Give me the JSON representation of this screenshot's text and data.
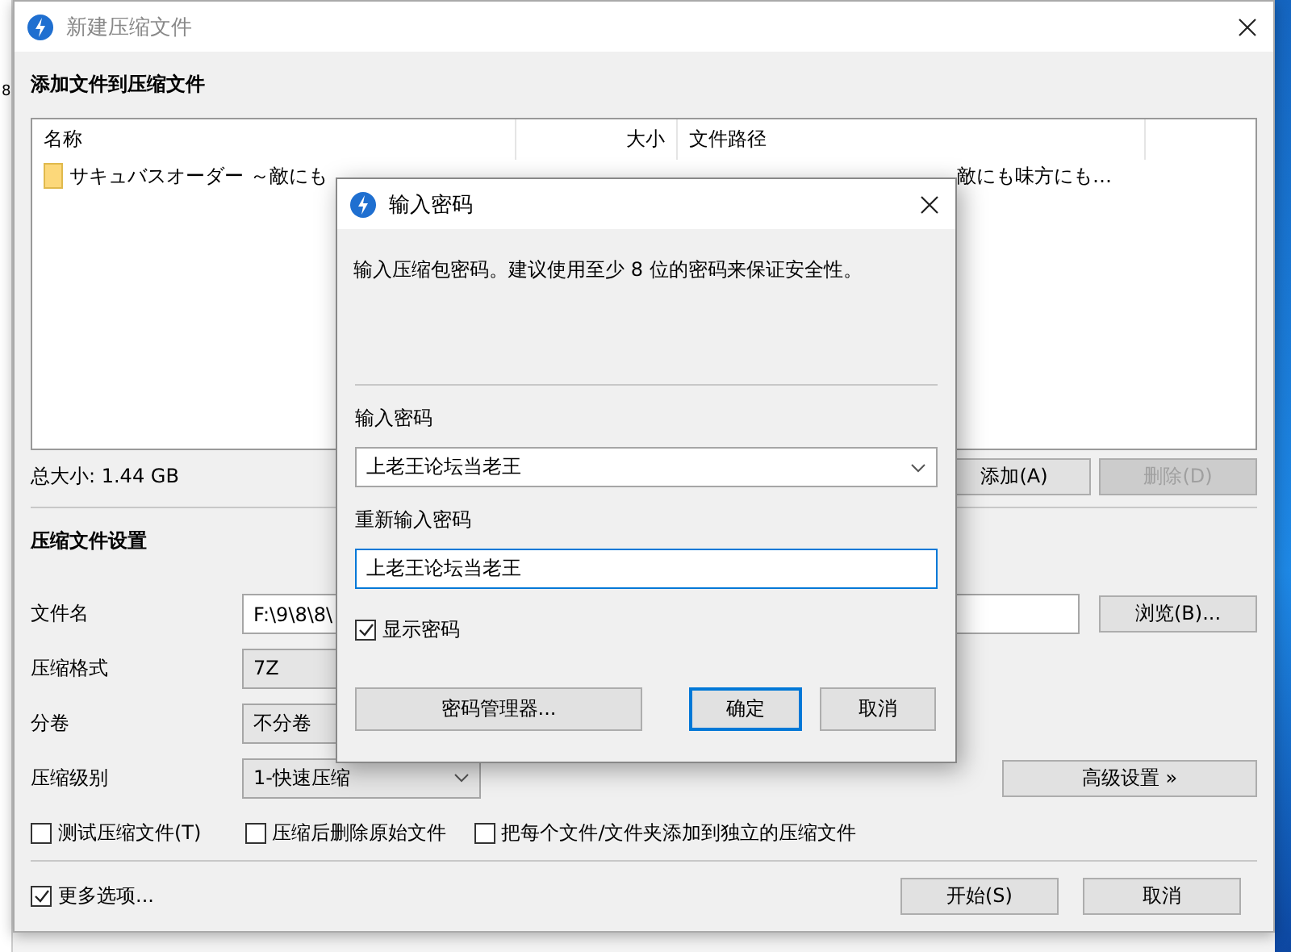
{
  "background_window": {
    "text": "8"
  },
  "window": {
    "title": "新建压缩文件"
  },
  "files": {
    "heading": "添加文件到压缩文件",
    "columns": [
      "名称",
      "大小",
      "文件路径"
    ],
    "rows": [
      {
        "name": "サキュバスオーダー ～敵にも",
        "path": "敵にも味方にも…"
      }
    ],
    "total_size": "总大小: 1.44 GB",
    "buttons": [
      {
        "label": "添加(A)",
        "disabled": false
      },
      {
        "label": "删除(D)",
        "disabled": true
      }
    ]
  },
  "settings": {
    "heading": "压缩文件设置",
    "filename": {
      "label": "文件名",
      "value": "F:\\9\\8\\8\\",
      "browse": "浏览(B)..."
    },
    "format": {
      "label": "压缩格式",
      "value": "7Z"
    },
    "split": {
      "label": "分卷",
      "value": "不分卷"
    },
    "level": {
      "label": "压缩级别",
      "value": "1-快速压缩",
      "advanced": "高级设置 »"
    },
    "options": [
      {
        "label": "测试压缩文件(T)",
        "checked": false
      },
      {
        "label": "压缩后删除原始文件",
        "checked": false
      },
      {
        "label": "把每个文件/文件夹添加到独立的压缩文件",
        "checked": false
      }
    ]
  },
  "footer": {
    "more_options": {
      "label": "更多选项...",
      "checked": true
    },
    "buttons": [
      {
        "label": "开始(S)"
      },
      {
        "label": "取消"
      }
    ]
  },
  "dialog": {
    "title": "输入密码",
    "description": "输入压缩包密码。建议使用至少 8 位的密码来保证安全性。",
    "password": {
      "label": "输入密码",
      "value": "上老王论坛当老王"
    },
    "confirm": {
      "label": "重新输入密码",
      "value": "上老王论坛当老王"
    },
    "show_password": {
      "label": "显示密码",
      "checked": true
    },
    "buttons": [
      {
        "label": "密码管理器...",
        "default": false
      },
      {
        "label": "确定",
        "default": true
      },
      {
        "label": "取消",
        "default": false
      }
    ]
  }
}
